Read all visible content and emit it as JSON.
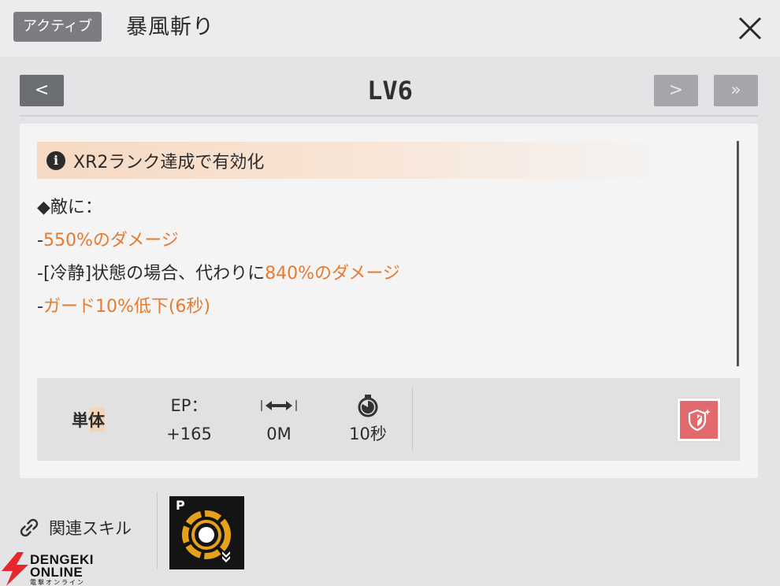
{
  "header": {
    "badge": "アクティブ",
    "title": "暴風斬り"
  },
  "nav": {
    "prev_label": "<",
    "level": "LV6",
    "next_label": ">",
    "last_label": "»"
  },
  "notice": {
    "text": "XR2ランク達成で有効化"
  },
  "effects": {
    "heading": "◆敵に：",
    "lines": [
      {
        "prefix": "-",
        "plain": "",
        "highlight": "550%のダメージ"
      },
      {
        "prefix": "-",
        "plain": "[冷静]状態の場合、代わりに",
        "highlight": "840%のダメージ"
      },
      {
        "prefix": "-",
        "plain": "",
        "highlight": "ガード10%低下(6秒)"
      }
    ]
  },
  "stats": {
    "target": "単体",
    "ep_label": "EP：",
    "ep_value": "+165",
    "range_value": "0M",
    "cooldown_value": "10秒"
  },
  "related": {
    "label": "関連スキル",
    "passive_letter": "P"
  },
  "watermark": {
    "line1": "DENGEKI",
    "line2": "ONLINE",
    "line3": "電撃オンライン"
  },
  "colors": {
    "accent_orange": "#e67a30",
    "shield_red": "#e36a6c",
    "passive_gold": "#e5a11a"
  }
}
